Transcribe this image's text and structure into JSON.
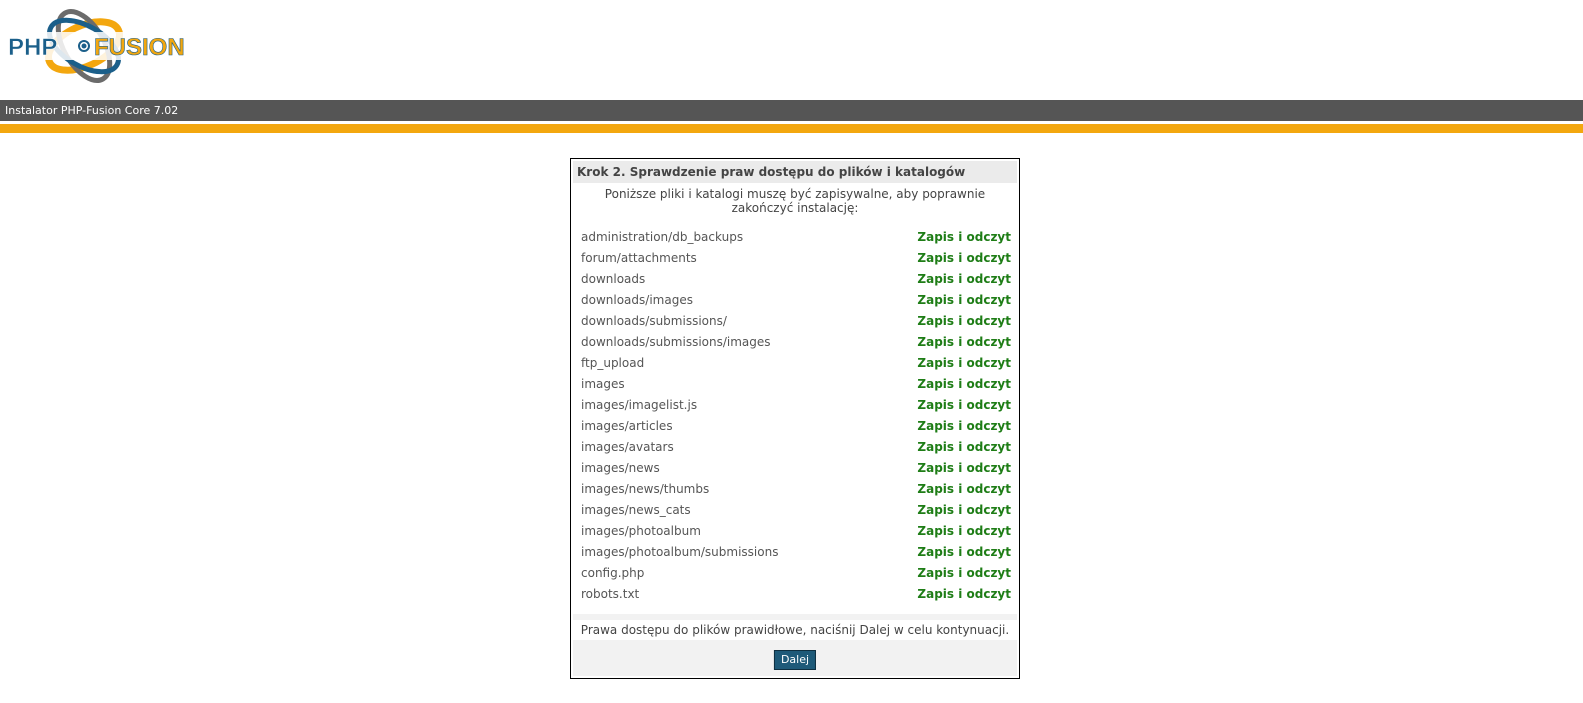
{
  "header": {
    "logo_text_php": "PHP",
    "logo_text_fusion": "FUSION",
    "colors": {
      "logo_blue": "#1b5f8a",
      "logo_orange": "#f3a70f"
    }
  },
  "titlebar": {
    "title": "Instalator PHP-Fusion Core 7.02"
  },
  "accent_color": "#f3a70f",
  "panel": {
    "title": "Krok 2. Sprawdzenie praw dostępu do plików i katalogów",
    "intro": "Poniższe pliki i katalogi muszę być zapisywalne, aby poprawnie zakończyć instalację:",
    "status_color": "#1e7d16",
    "items": [
      {
        "path": "administration/db_backups",
        "status": "Zapis i odczyt"
      },
      {
        "path": "forum/attachments",
        "status": "Zapis i odczyt"
      },
      {
        "path": "downloads",
        "status": "Zapis i odczyt"
      },
      {
        "path": "downloads/images",
        "status": "Zapis i odczyt"
      },
      {
        "path": "downloads/submissions/",
        "status": "Zapis i odczyt"
      },
      {
        "path": "downloads/submissions/images",
        "status": "Zapis i odczyt"
      },
      {
        "path": "ftp_upload",
        "status": "Zapis i odczyt"
      },
      {
        "path": "images",
        "status": "Zapis i odczyt"
      },
      {
        "path": "images/imagelist.js",
        "status": "Zapis i odczyt"
      },
      {
        "path": "images/articles",
        "status": "Zapis i odczyt"
      },
      {
        "path": "images/avatars",
        "status": "Zapis i odczyt"
      },
      {
        "path": "images/news",
        "status": "Zapis i odczyt"
      },
      {
        "path": "images/news/thumbs",
        "status": "Zapis i odczyt"
      },
      {
        "path": "images/news_cats",
        "status": "Zapis i odczyt"
      },
      {
        "path": "images/photoalbum",
        "status": "Zapis i odczyt"
      },
      {
        "path": "images/photoalbum/submissions",
        "status": "Zapis i odczyt"
      },
      {
        "path": "config.php",
        "status": "Zapis i odczyt"
      },
      {
        "path": "robots.txt",
        "status": "Zapis i odczyt"
      }
    ],
    "footer_message": "Prawa dostępu do plików prawidłowe, naciśnij Dalej w celu kontynuacji.",
    "next_button_label": "Dalej"
  }
}
